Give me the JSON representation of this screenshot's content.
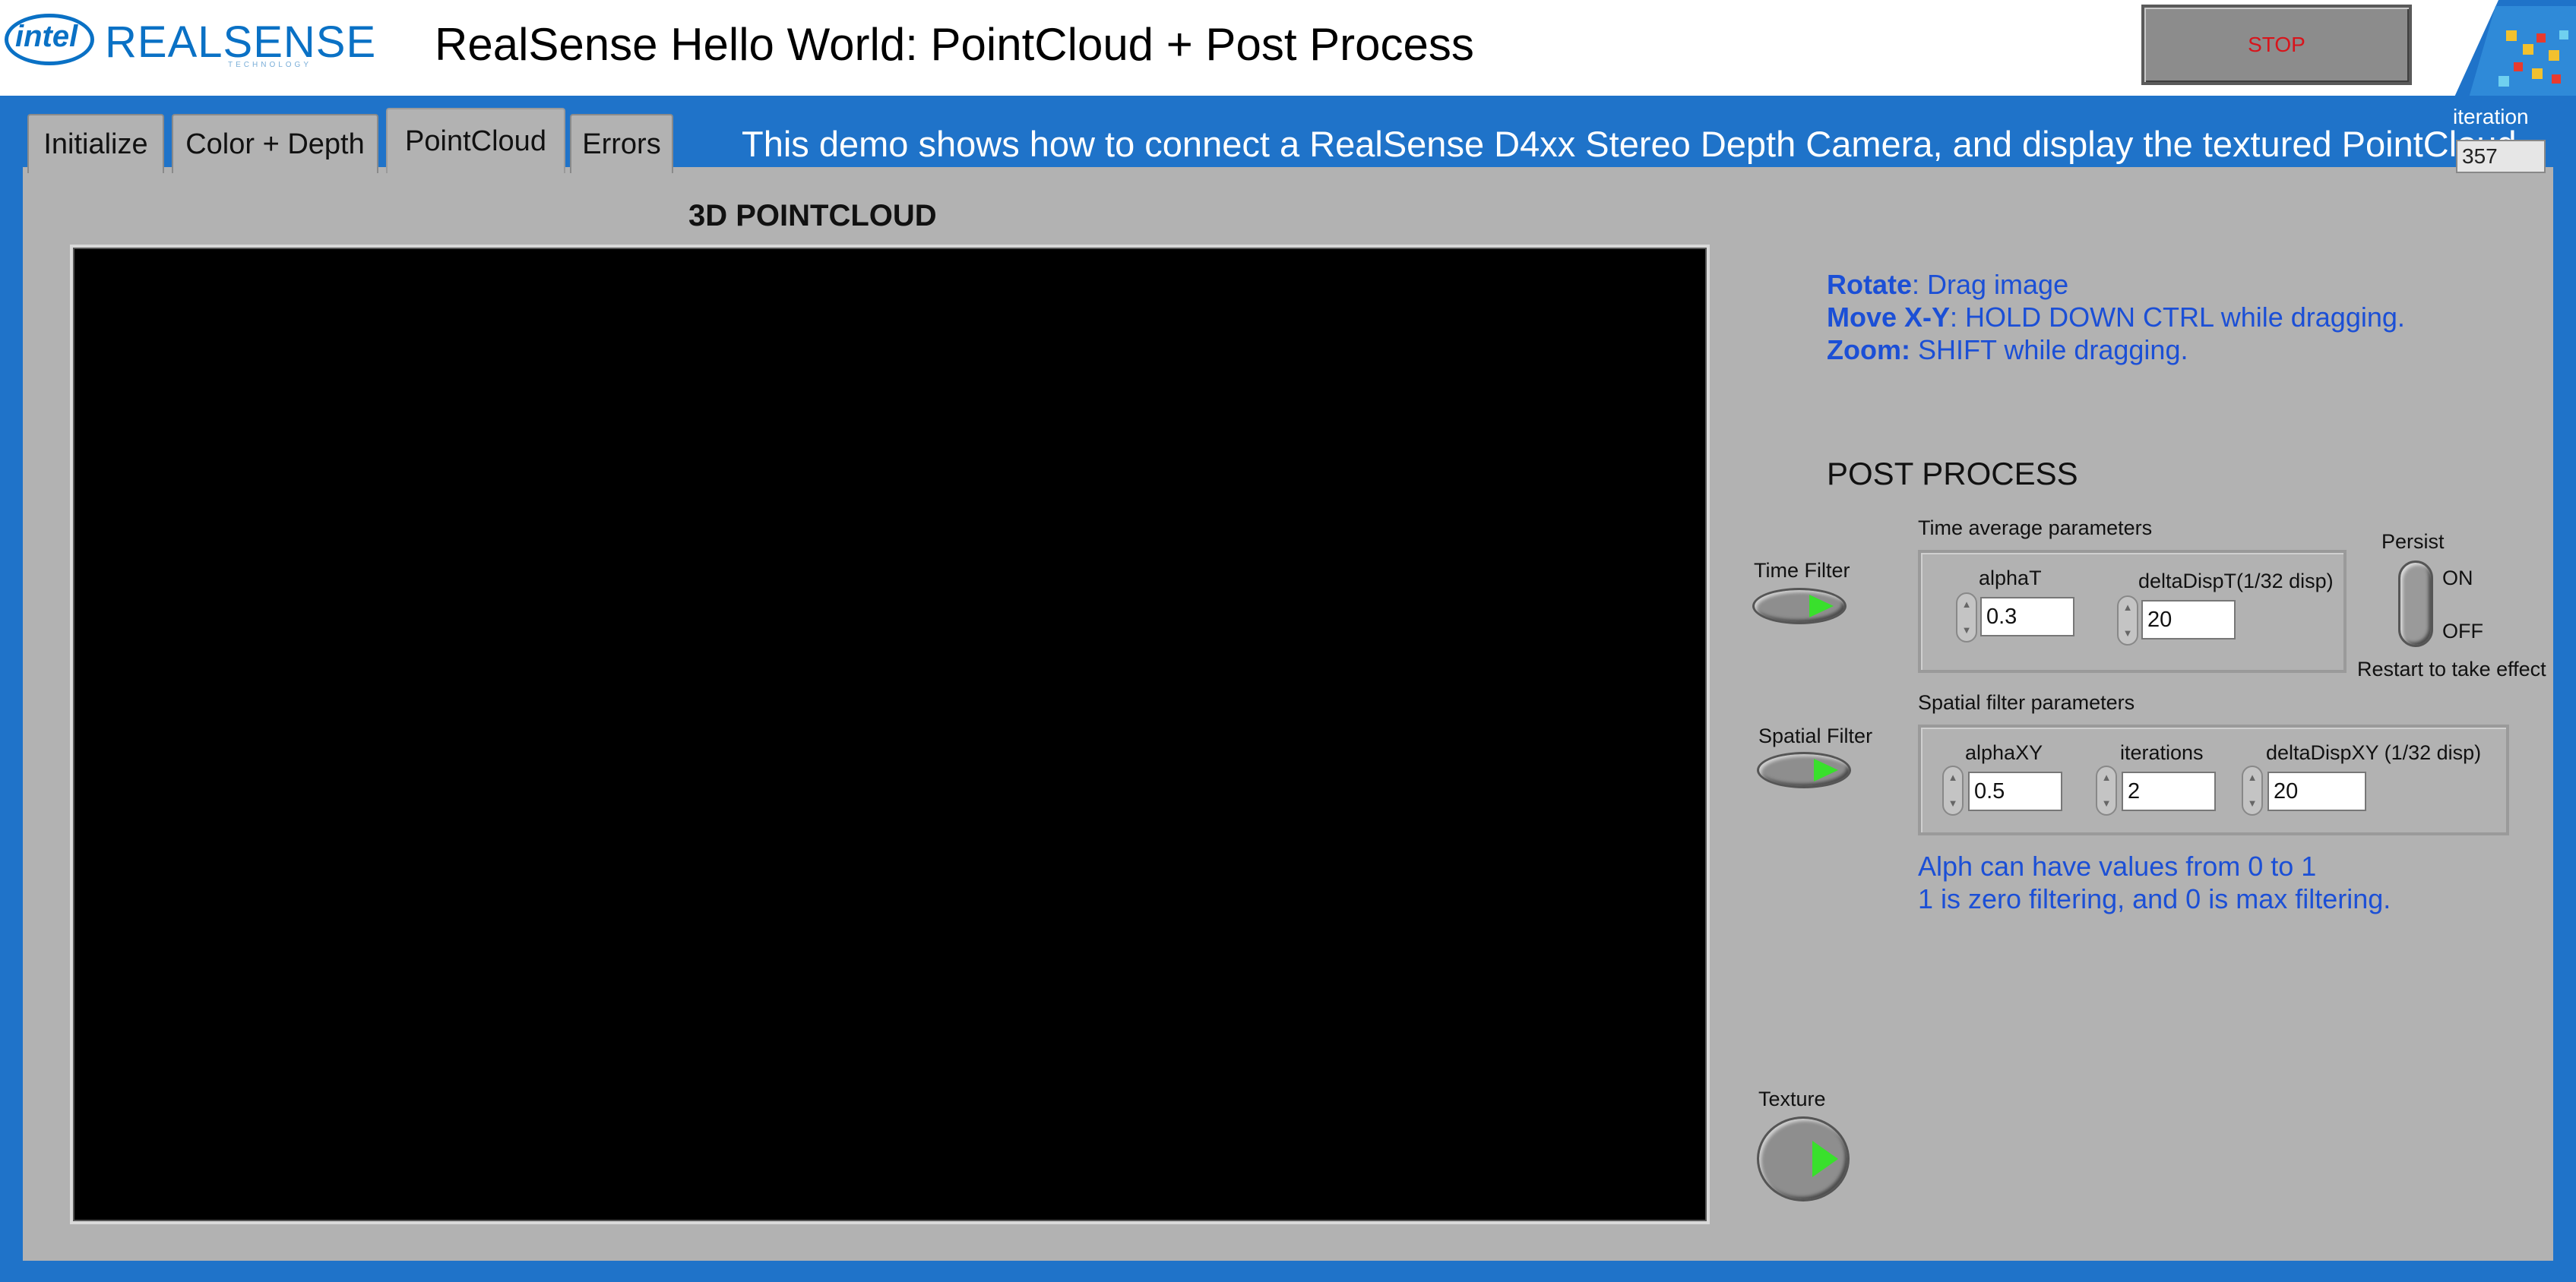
{
  "header": {
    "logo_intel": "intel",
    "logo_realsense": "REALSENSE",
    "logo_tech": "TECHNOLOGY",
    "title": "RealSense Hello World: PointCloud + Post Process",
    "stop_label": "STOP"
  },
  "tabs": [
    {
      "label": "Initialize"
    },
    {
      "label": "Color + Depth"
    },
    {
      "label": "PointCloud"
    },
    {
      "label": "Errors"
    }
  ],
  "active_tab": "PointCloud",
  "demo_text": "This demo shows how to connect a RealSense D4xx Stereo Depth Camera, and display the textured PointCloud.",
  "iteration": {
    "label": "iteration",
    "value": "357"
  },
  "pointcloud": {
    "title": "3D POINTCLOUD"
  },
  "help": {
    "rotate_key": "Rotate",
    "rotate_text": ": Drag image",
    "move_key": "Move X-Y",
    "move_text": ": HOLD DOWN CTRL while dragging.",
    "zoom_key": "Zoom:",
    "zoom_text": " SHIFT while dragging."
  },
  "post_process": {
    "title": "POST PROCESS",
    "time_filter_label": "Time Filter",
    "spatial_filter_label": "Spatial Filter",
    "texture_label": "Texture",
    "time_avg": {
      "label": "Time average parameters",
      "alphaT_label": "alphaT",
      "alphaT_value": "0.3",
      "deltaDispT_label": "deltaDispT(1/32 disp)",
      "deltaDispT_value": "20"
    },
    "persist": {
      "label": "Persist",
      "on": "ON",
      "off": "OFF",
      "note": "Restart to take effect"
    },
    "spatial": {
      "label": "Spatial filter parameters",
      "alphaXY_label": "alphaXY",
      "alphaXY_value": "0.5",
      "iterations_label": "iterations",
      "iterations_value": "2",
      "deltaDispXY_label": "deltaDispXY (1/32 disp)",
      "deltaDispXY_value": "20"
    },
    "note_line1": "Alph can have values from 0 to 1",
    "note_line2": "1 is zero filtering, and 0 is max filtering."
  },
  "colors": {
    "frame": "#1f73c9",
    "panel": "#b2b2b2",
    "help_text": "#1b4fd6",
    "led_on": "#39e02c",
    "stop_text": "#d8141b"
  }
}
